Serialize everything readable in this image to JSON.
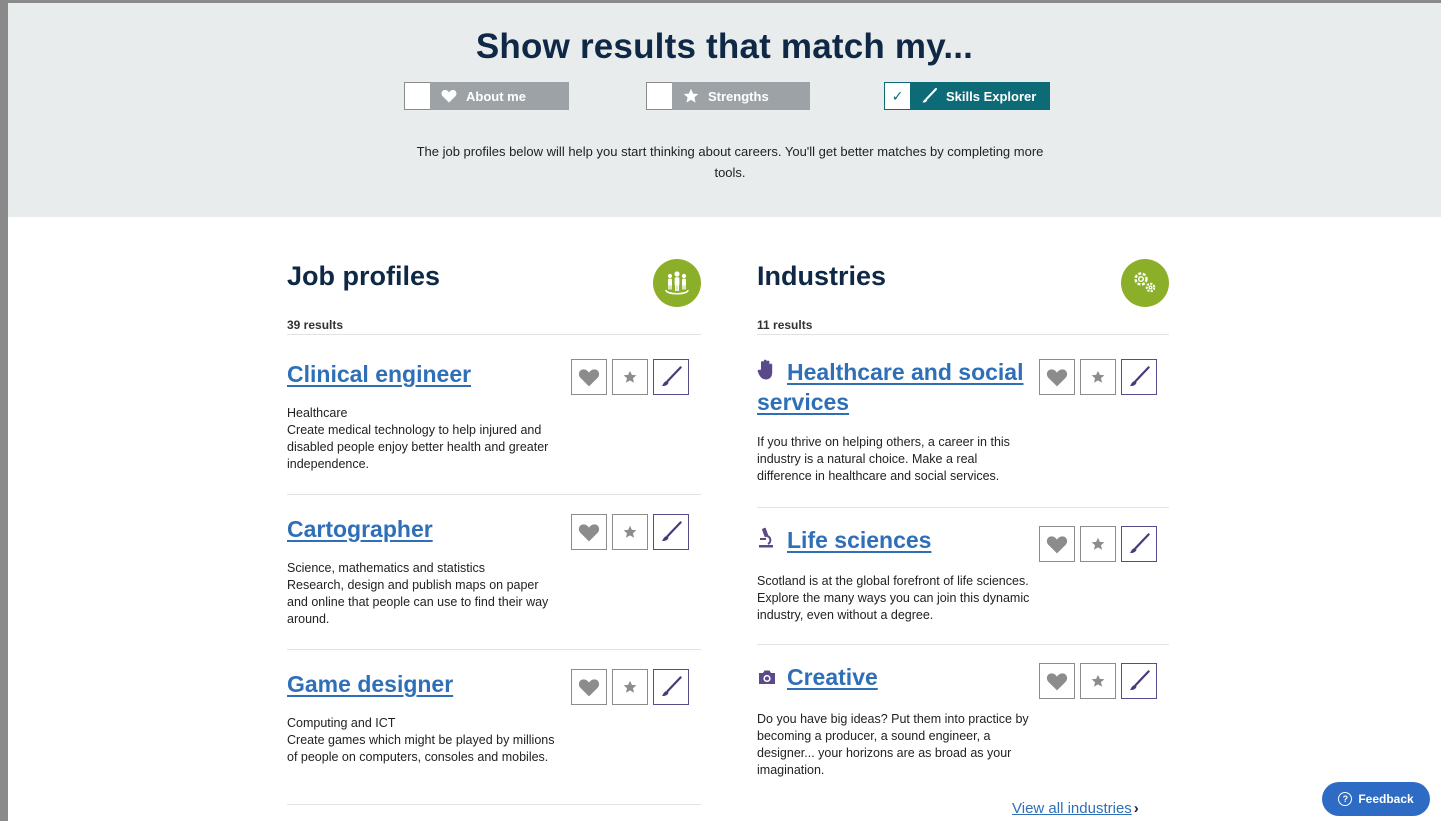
{
  "filters": {
    "title": "Show results that match my...",
    "toggles": [
      {
        "label": "About me",
        "checked": false,
        "icon": "heart-icon"
      },
      {
        "label": "Strengths",
        "checked": false,
        "icon": "star-icon"
      },
      {
        "label": "Skills Explorer",
        "checked": true,
        "check_mark": "✓",
        "icon": "paintbrush-icon"
      }
    ],
    "intro": "The job profiles below will help you start thinking about careers. You'll get better matches by completing more tools."
  },
  "job_profiles": {
    "title": "Job profiles",
    "count": "39 results",
    "badge_icon": "people-icon",
    "items": [
      {
        "title": "Clinical engineer",
        "category": "Healthcare",
        "description": "Create medical technology to help injured and disabled people enjoy better health and greater independence."
      },
      {
        "title": "Cartographer",
        "category": "Science, mathematics and statistics",
        "description": "Research, design and publish maps on paper and online that people can use to find their way around."
      },
      {
        "title": "Game designer",
        "category": "Computing and ICT",
        "description": "Create games which might be played by millions of people on computers, consoles and mobiles."
      }
    ]
  },
  "industries": {
    "title": "Industries",
    "count": "11 results",
    "badge_icon": "gears-icon",
    "items": [
      {
        "title": "Healthcare and social services",
        "title_line1": "Healthcare and social",
        "title_line2": "services",
        "icon": "hand-icon",
        "description": "If you thrive on helping others, a career in this industry is a natural choice. Make a real difference in healthcare and social services."
      },
      {
        "title": "Life sciences",
        "icon": "microscope-icon",
        "description": "Scotland is at the global forefront of life sciences. Explore the many ways you can join this dynamic industry, even without a degree."
      },
      {
        "title": "Creative",
        "icon": "camera-icon",
        "description": "Do you have big ideas? Put them into practice by becoming a producer, a sound engineer, a designer... your horizons are as broad as your imagination."
      }
    ],
    "view_all": "View all industries",
    "view_all_chevron": "›"
  },
  "feedback": {
    "label": "Feedback",
    "icon_glyph": "?"
  },
  "colors": {
    "navy": "#0e2846",
    "teal": "#0d6b77",
    "link": "#2f6fb8",
    "badge_green": "#8caf2a",
    "skill_purple": "#5a4a8a",
    "band": "#e9ecec"
  }
}
